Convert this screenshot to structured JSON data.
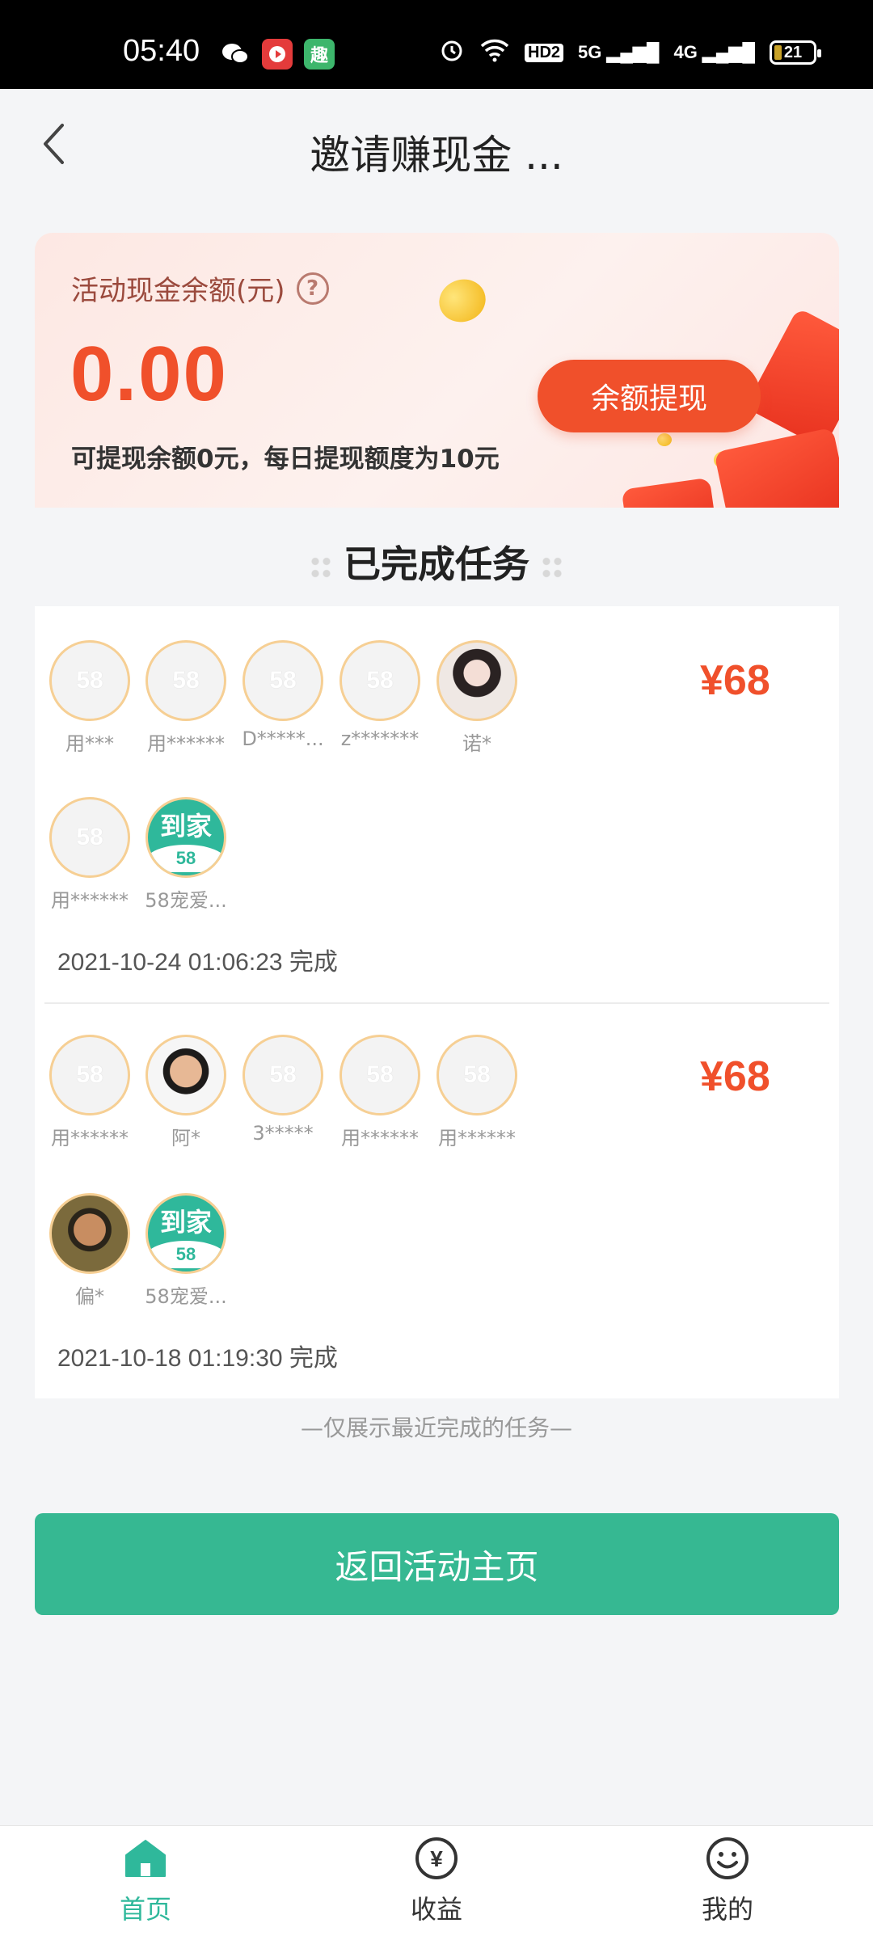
{
  "status_bar": {
    "time": "05:40",
    "apps": [
      "wechat-icon",
      "video-app-icon",
      "qu-app-icon"
    ],
    "qu_label": "趣",
    "hd_label": "HD2",
    "net1": "5G",
    "net2": "4G",
    "battery": "21"
  },
  "header": {
    "title": "邀请赚现金 ..."
  },
  "balance": {
    "label": "活动现金余额(元)",
    "help_glyph": "?",
    "amount": "0.00",
    "note": "可提现余额0元，每日提现额度为10元",
    "withdraw_label": "余额提现"
  },
  "section_title": "已完成任务",
  "tasks": [
    {
      "reward": "¥68",
      "time": "2021-10-24 01:06:23 完成",
      "avatars": [
        {
          "name": "用***",
          "placeholder": "58"
        },
        {
          "name": "用******",
          "placeholder": "58"
        },
        {
          "name": "D*****...",
          "placeholder": "58"
        },
        {
          "name": "z*******",
          "placeholder": "58"
        },
        {
          "name": "诺*",
          "placeholder": ""
        },
        {
          "name": "用******",
          "placeholder": "58"
        },
        {
          "name": "58宠爱...",
          "placeholder": ""
        }
      ]
    },
    {
      "reward": "¥68",
      "time": "2021-10-18 01:19:30 完成",
      "avatars": [
        {
          "name": "用******",
          "placeholder": "58"
        },
        {
          "name": "阿*",
          "placeholder": ""
        },
        {
          "name": "3*****",
          "placeholder": "58"
        },
        {
          "name": "用******",
          "placeholder": "58"
        },
        {
          "name": "用******",
          "placeholder": "58"
        },
        {
          "name": "偏*",
          "placeholder": ""
        },
        {
          "name": "58宠爱...",
          "placeholder": ""
        }
      ]
    }
  ],
  "daojia": {
    "top": "到家",
    "bottom": "58"
  },
  "footer_note": "—仅展示最近完成的任务—",
  "back_button": "返回活动主页",
  "nav": {
    "home": "首页",
    "income": "收益",
    "mine": "我的",
    "income_glyph": "¥"
  },
  "colors": {
    "accent_green": "#36b892",
    "accent_orange": "#f0502b"
  }
}
